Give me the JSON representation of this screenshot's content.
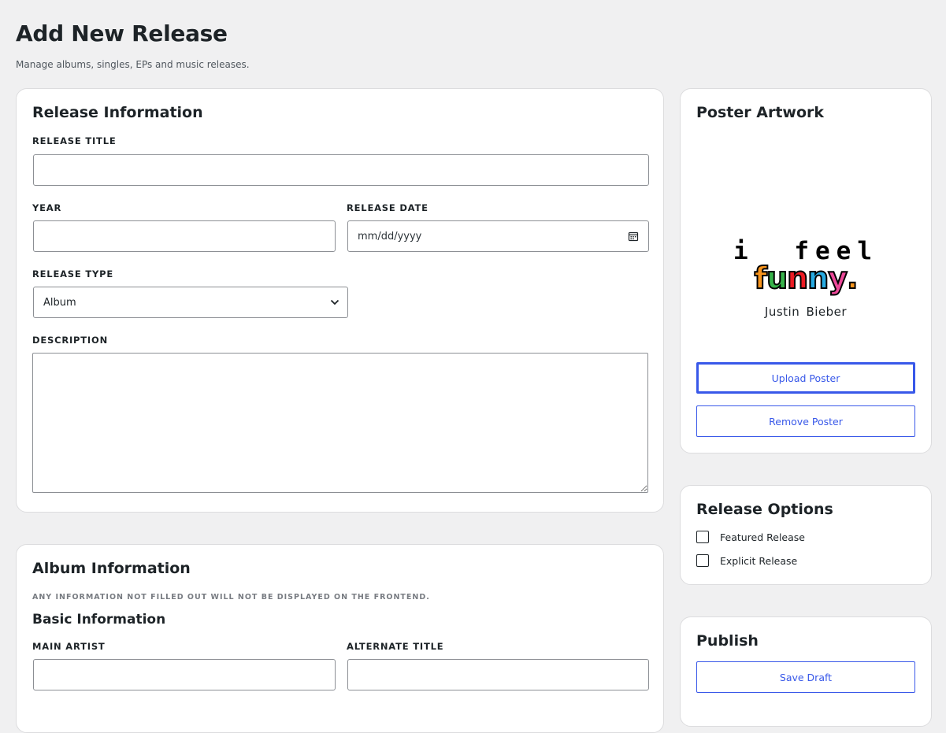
{
  "page": {
    "title": "Add New Release",
    "subtitle": "Manage albums, singles, EPs and music releases."
  },
  "release_info": {
    "title": "Release Information",
    "release_title_label": "RELEASE TITLE",
    "release_title_value": "",
    "year_label": "YEAR",
    "year_value": "",
    "release_date_label": "RELEASE DATE",
    "release_date_placeholder": "mm/dd/yyyy",
    "release_type_label": "RELEASE TYPE",
    "release_type_value": "Album",
    "description_label": "DESCRIPTION",
    "description_value": ""
  },
  "album_info": {
    "title": "Album Information",
    "helper": "ANY INFORMATION NOT FILLED OUT WILL NOT BE DISPLAYED ON THE FRONTEND.",
    "basic_title": "Basic Information",
    "main_artist_label": "MAIN ARTIST",
    "alternate_title_label": "ALTERNATE TITLE"
  },
  "poster": {
    "title": "Poster Artwork",
    "art_line1": "i feel",
    "art_line2_letters": [
      "f",
      "u",
      "n",
      "n",
      "y",
      "."
    ],
    "art_line2_colors": [
      "#f7941d",
      "#37b34a",
      "#ec1c24",
      "#27aae1",
      "#ec4899",
      "#f7941d"
    ],
    "art_artist": "Justin Bieber",
    "upload_label": "Upload Poster",
    "remove_label": "Remove Poster"
  },
  "options": {
    "title": "Release Options",
    "featured_label": "Featured Release",
    "featured_checked": false,
    "explicit_label": "Explicit Release",
    "explicit_checked": false
  },
  "publish": {
    "title": "Publish",
    "save_draft_label": "Save Draft"
  },
  "colors": {
    "accent": "#3858e9",
    "background": "#f0f0f1"
  }
}
